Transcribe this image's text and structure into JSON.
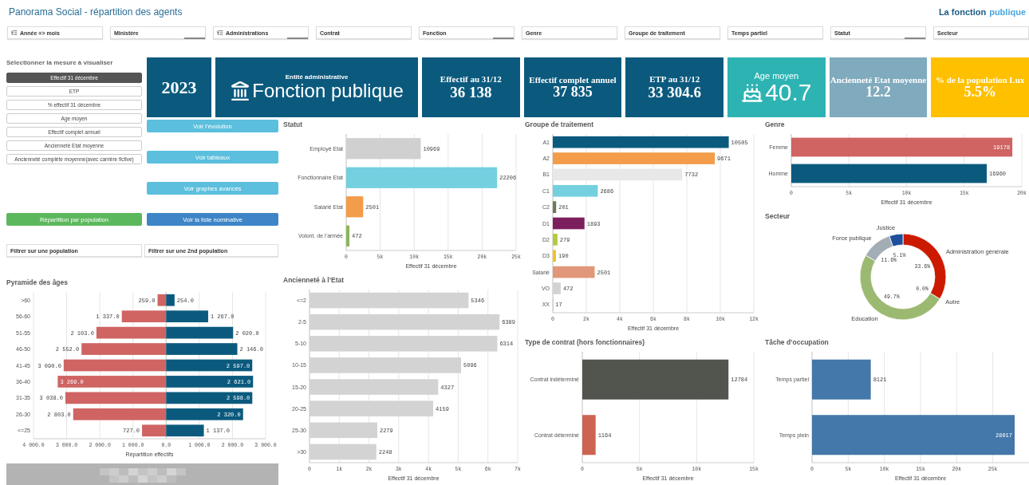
{
  "header": {
    "title": "Panorama Social - répartition des agents",
    "brand": {
      "primary": "La fonction",
      "secondary": "publique"
    }
  },
  "filter_bar": [
    {
      "label": "Année => mois",
      "has_icon": true,
      "selection_bar": false
    },
    {
      "label": "Ministère",
      "has_icon": false,
      "selection_bar": true
    },
    {
      "label": "Administrations",
      "has_icon": true,
      "selection_bar": true
    },
    {
      "label": "Contrat",
      "has_icon": false,
      "selection_bar": false
    },
    {
      "label": "Fonction",
      "has_icon": false,
      "selection_bar": true
    },
    {
      "label": "Genre",
      "has_icon": false,
      "selection_bar": false
    },
    {
      "label": "Groupe de traitement",
      "has_icon": false,
      "selection_bar": false
    },
    {
      "label": "Temps partiel",
      "has_icon": false,
      "selection_bar": false
    },
    {
      "label": "Statut",
      "has_icon": false,
      "selection_bar": true
    },
    {
      "label": "Secteur",
      "has_icon": false,
      "selection_bar": false
    }
  ],
  "measures": {
    "heading": "Sélectionner la mesure à visualiser",
    "items": [
      {
        "label": "Effectif 31 décembre",
        "selected": true
      },
      {
        "label": "ETP",
        "selected": false
      },
      {
        "label": "% effectif 31 décembre",
        "selected": false
      },
      {
        "label": "Age moyen",
        "selected": false
      },
      {
        "label": "Effectif complet annuel",
        "selected": false
      },
      {
        "label": "Ancienneté Etat moyenne",
        "selected": false
      },
      {
        "label": "Ancienneté complète moyenne(avec carrière fictive)",
        "selected": false
      }
    ]
  },
  "kpis": [
    {
      "kind": "year",
      "value": "2023",
      "color": "#0b5a7e"
    },
    {
      "kind": "entity",
      "label": "Entité administrative",
      "value": "Fonction publique",
      "color": "#0b5a7e"
    },
    {
      "kind": "metric",
      "label": "Effectif au 31/12",
      "value": "36 138",
      "color": "#0b5a7e"
    },
    {
      "kind": "metric",
      "label": "Effectif complet annuel",
      "value": "37 835",
      "color": "#0b5a7e"
    },
    {
      "kind": "metric",
      "label": "ETP au 31/12",
      "value": "33 304.6",
      "color": "#0b5a7e"
    },
    {
      "kind": "icon_metric",
      "label": "Age moyen",
      "value": "40.7",
      "color": "#2eb3b3"
    },
    {
      "kind": "metric",
      "label": "Ancienneté Etat moyenne",
      "value": "12.2",
      "color": "#80aabd"
    },
    {
      "kind": "metric",
      "label": "% de la population Lux",
      "value": "5.5%",
      "color": "#ffc000"
    }
  ],
  "actions": [
    {
      "label": "Voir l’évolution",
      "color": "#5bbfdd"
    },
    {
      "label": "Voir tableaux",
      "color": "#5bbfdd"
    },
    {
      "label": "Voir graphes avancés",
      "color": "#5bbfdd"
    },
    {
      "label": "Voir la liste nominative",
      "color": "#3d85c6"
    }
  ],
  "population_button": {
    "label": "Répartition par population",
    "color": "#5cb85c"
  },
  "population_filters": [
    {
      "label": "Filtrer sur une population"
    },
    {
      "label": "Filtrer sur une 2nd population"
    }
  ],
  "pyramid": {
    "title": "Pyramide des âges",
    "chart_data": {
      "type": "bar",
      "orientation": "horizontal",
      "stacked": true,
      "grid": true,
      "xlabel": "Répartition effectifs",
      "categories": [
        ">60",
        "56-60",
        "51-55",
        "46-50",
        "41-45",
        "36-40",
        "31-35",
        "26-30",
        "<=25"
      ],
      "series": [
        {
          "color": "#cf6463",
          "values": [
            -259,
            -1337,
            -2103,
            -2552,
            -3090,
            -3269,
            -3038,
            -2803,
            -727
          ]
        },
        {
          "color": "#0b5a7e",
          "values": [
            254,
            1267,
            2020,
            2146,
            2597,
            2621,
            2598,
            2320,
            1137
          ]
        }
      ],
      "value_labels": [
        [
          "259.0",
          "1 337.0",
          "2 103.0",
          "2 552.0",
          "3 090.0",
          "3 269.0",
          "3 038.0",
          "2 803.0",
          "727.0"
        ],
        [
          "254.0",
          "1 267.0",
          "2 020.0",
          "2 146.0",
          "2 597.0",
          "2 621.0",
          "2 598.0",
          "2 320.0",
          "1 137.0"
        ]
      ],
      "xlim": [
        -4000,
        3000
      ],
      "xticks": [
        {
          "value": -4000,
          "label": "4 000.0"
        },
        {
          "value": -3000,
          "label": "3 000.0"
        },
        {
          "value": -2000,
          "label": "2 000.0"
        },
        {
          "value": -1000,
          "label": "1 000.0"
        },
        {
          "value": 0,
          "label": "0.0"
        },
        {
          "value": 1000,
          "label": "1 000.0"
        },
        {
          "value": 2000,
          "label": "2 000.0"
        },
        {
          "value": 3000,
          "label": "3 000.0"
        }
      ]
    }
  },
  "redacted_banner": true,
  "statut": {
    "title": "Statut",
    "chart_data": {
      "type": "bar",
      "orientation": "horizontal",
      "stacked": true,
      "grid": true,
      "xlabel": "Effectif 31 décembre",
      "data_labels": true,
      "categories": [
        "Employé Etat",
        "Fonctionnaire Etat",
        "Salarié Etat",
        "Volont. de l’armée"
      ],
      "series": [
        {
          "color": "#d0d0d0",
          "values": [
            10969,
            null,
            null,
            null
          ]
        },
        {
          "color": "#74d0de",
          "values": [
            null,
            22206,
            null,
            null
          ]
        },
        {
          "color": "#f39c4a",
          "values": [
            null,
            null,
            2501,
            null
          ]
        },
        {
          "color": "#8ab55a",
          "values": [
            null,
            null,
            null,
            472
          ]
        }
      ],
      "xlim": [
        0,
        25000
      ],
      "xticks": [
        0,
        {
          "value": 5000,
          "label": "5k"
        },
        {
          "value": 10000,
          "label": "10k"
        },
        {
          "value": 15000,
          "label": "15k"
        },
        {
          "value": 20000,
          "label": "20k"
        },
        {
          "value": 25000,
          "label": "25k"
        }
      ]
    }
  },
  "anciennete": {
    "title": "Ancienneté à l’Etat",
    "chart_data": {
      "type": "bar",
      "orientation": "horizontal",
      "grid": true,
      "xlabel": "Effectif 31 décembre",
      "data_labels": true,
      "categories": [
        "<=2",
        "2-5",
        "5-10",
        "10-15",
        "15-20",
        "20-25",
        "25-30",
        ">30"
      ],
      "series": [
        {
          "color": "#d3d3d3",
          "values": [
            5346,
            6389,
            6314,
            5096,
            4327,
            4159,
            2279,
            2248
          ]
        }
      ],
      "xlim": [
        0,
        7000
      ],
      "xticks": [
        0,
        {
          "value": 1000,
          "label": "1k"
        },
        {
          "value": 2000,
          "label": "2k"
        },
        {
          "value": 3000,
          "label": "3k"
        },
        {
          "value": 4000,
          "label": "4k"
        },
        {
          "value": 5000,
          "label": "5k"
        },
        {
          "value": 6000,
          "label": "6k"
        },
        {
          "value": 7000,
          "label": "7k"
        }
      ]
    }
  },
  "groupe": {
    "title": "Groupe de traitement",
    "chart_data": {
      "type": "bar",
      "orientation": "horizontal",
      "stacked": true,
      "grid": true,
      "xlabel": "Effectif 31 décembre",
      "data_labels": true,
      "categories": [
        "A1",
        "A2",
        "B1",
        "C1",
        "C2",
        "D1",
        "D2",
        "D3",
        "Salarié",
        "VO",
        "XX"
      ],
      "series": [
        {
          "color": "#0b5a7e",
          "values": [
            10505,
            null,
            null,
            null,
            null,
            null,
            null,
            null,
            null,
            null,
            null
          ]
        },
        {
          "color": "#f39c4a",
          "values": [
            null,
            9671,
            null,
            null,
            null,
            null,
            null,
            null,
            null,
            null,
            null
          ]
        },
        {
          "color": "#e8e8e8",
          "values": [
            null,
            null,
            7732,
            null,
            null,
            null,
            null,
            null,
            null,
            null,
            null
          ]
        },
        {
          "color": "#74d0de",
          "values": [
            null,
            null,
            null,
            2686,
            null,
            null,
            null,
            null,
            null,
            null,
            null
          ]
        },
        {
          "color": "#6b7a5a",
          "values": [
            null,
            null,
            null,
            null,
            201,
            null,
            null,
            null,
            null,
            null,
            null
          ]
        },
        {
          "color": "#7d1f5e",
          "values": [
            null,
            null,
            null,
            null,
            null,
            1893,
            null,
            null,
            null,
            null,
            null
          ]
        },
        {
          "color": "#b5c840",
          "values": [
            null,
            null,
            null,
            null,
            null,
            null,
            279,
            null,
            null,
            null,
            null
          ]
        },
        {
          "color": "#f0c420",
          "values": [
            null,
            null,
            null,
            null,
            null,
            null,
            null,
            190,
            null,
            null,
            null
          ]
        },
        {
          "color": "#e0977a",
          "values": [
            null,
            null,
            null,
            null,
            null,
            null,
            null,
            null,
            2501,
            null,
            null
          ]
        },
        {
          "color": "#d3d3d3",
          "values": [
            null,
            null,
            null,
            null,
            null,
            null,
            null,
            null,
            null,
            472,
            null
          ]
        },
        {
          "color": "#c8c8c8",
          "values": [
            null,
            null,
            null,
            null,
            null,
            null,
            null,
            null,
            null,
            null,
            17
          ]
        }
      ],
      "xlim": [
        0,
        12000
      ],
      "xticks": [
        0,
        {
          "value": 2000,
          "label": "2k"
        },
        {
          "value": 4000,
          "label": "4k"
        },
        {
          "value": 6000,
          "label": "6k"
        },
        {
          "value": 8000,
          "label": "8k"
        },
        {
          "value": 10000,
          "label": "10k"
        },
        {
          "value": 12000,
          "label": "12k"
        }
      ]
    }
  },
  "type_contrat": {
    "title": "Type de contrat (hors fonctionnaires)",
    "chart_data": {
      "type": "bar",
      "orientation": "horizontal",
      "stacked": true,
      "grid": true,
      "xlabel": "Effectif 31 décembre",
      "data_labels": true,
      "categories": [
        "Contrat indéterminé",
        "Contrat déterminé"
      ],
      "series": [
        {
          "color": "#52544e",
          "values": [
            12784,
            null
          ]
        },
        {
          "color": "#cd6451",
          "values": [
            null,
            1164
          ]
        }
      ],
      "xlim": [
        0,
        15000
      ],
      "xticks": [
        0,
        {
          "value": 5000,
          "label": "5k"
        },
        {
          "value": 10000,
          "label": "10k"
        },
        {
          "value": 15000,
          "label": "15k"
        }
      ]
    }
  },
  "genre": {
    "title": "Genre",
    "chart_data": {
      "type": "bar",
      "orientation": "horizontal",
      "stacked": true,
      "grid": true,
      "xlabel": "Effectif 31 décembre",
      "data_labels": true,
      "categories": [
        "Femme",
        "Homme"
      ],
      "series": [
        {
          "color": "#cf6463",
          "values": [
            19178,
            null
          ]
        },
        {
          "color": "#0b5a7e",
          "values": [
            null,
            16960
          ]
        }
      ],
      "xlim": [
        0,
        20000
      ],
      "xticks": [
        0,
        {
          "value": 5000,
          "label": "5k"
        },
        {
          "value": 10000,
          "label": "10k"
        },
        {
          "value": 15000,
          "label": "15k"
        },
        {
          "value": 20000,
          "label": "20k"
        }
      ]
    }
  },
  "secteur": {
    "title": "Secteur",
    "chart_data": {
      "type": "donut",
      "categories": [
        "Administration générale",
        "Autre",
        "Education",
        "Force publique",
        "Justice"
      ],
      "series": [
        {
          "colors": [
            "#cc1a00",
            "#e8a030",
            "#9cb972",
            "#a3adb5",
            "#1f4f9c"
          ],
          "values": [
            33.6,
            0.0,
            49.7,
            11.6,
            5.1
          ]
        }
      ],
      "value_labels": [
        "33.6%",
        "0.0%",
        "49.7%",
        "11.6%",
        "5.1%"
      ]
    }
  },
  "tache": {
    "title": "Tâche d’occupation",
    "chart_data": {
      "type": "bar",
      "orientation": "horizontal",
      "grid": true,
      "xlabel": "Effectif 31 décembre",
      "data_labels": true,
      "categories": [
        "Temps partiel",
        "Temps plein"
      ],
      "series": [
        {
          "color": "#4477aa",
          "values": [
            8121,
            28017
          ]
        }
      ],
      "xlim": [
        0,
        30000
      ],
      "xticks": [
        0,
        {
          "value": 5000,
          "label": "5k"
        },
        {
          "value": 10000,
          "label": "10k"
        },
        {
          "value": 15000,
          "label": "15k"
        },
        {
          "value": 20000,
          "label": "20k"
        },
        {
          "value": 25000,
          "label": "25k"
        }
      ]
    }
  }
}
